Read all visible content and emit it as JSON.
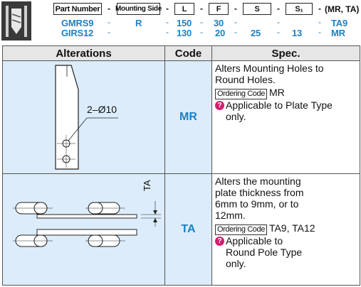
{
  "header": {
    "labels": [
      "Part Number",
      "Mounting Side",
      "L",
      "F",
      "S",
      "S₁"
    ],
    "dash": "-",
    "suffix": "(MR, TA)",
    "rows": [
      {
        "part": "GMRS9",
        "side": "R",
        "L": "150",
        "F": "30",
        "S": "",
        "S1": "",
        "alt": "TA9"
      },
      {
        "part": "GIRS12",
        "side": "",
        "L": "130",
        "F": "20",
        "S": "25",
        "S1": "13",
        "alt": "MR"
      }
    ]
  },
  "table": {
    "columns": [
      "Alterations",
      "Code",
      "Spec."
    ],
    "rows": [
      {
        "code": "MR",
        "figure_label": "2–Ø10",
        "spec_text": "Alters Mounting Holes to Round Holes.",
        "ordering_label": "Ordering Code",
        "ordering_value": "MR",
        "note_icon": "warning-icon",
        "note": "Applicable to Plate Type only."
      },
      {
        "code": "TA",
        "figure_label": "TA",
        "spec_text": "Alters the mounting plate thickness from 6mm to 9mm, or to 12mm.",
        "ordering_label": "Ordering Code",
        "ordering_value": "TA9, TA12",
        "note_icon": "warning-icon",
        "note": "Applicable to Round Pole Type only."
      }
    ]
  },
  "colors": {
    "code_blue": "#1a82c6",
    "cell_blue": "#dcecfa",
    "header_gray": "#e6e6e6",
    "warn": "#d11f6e"
  }
}
